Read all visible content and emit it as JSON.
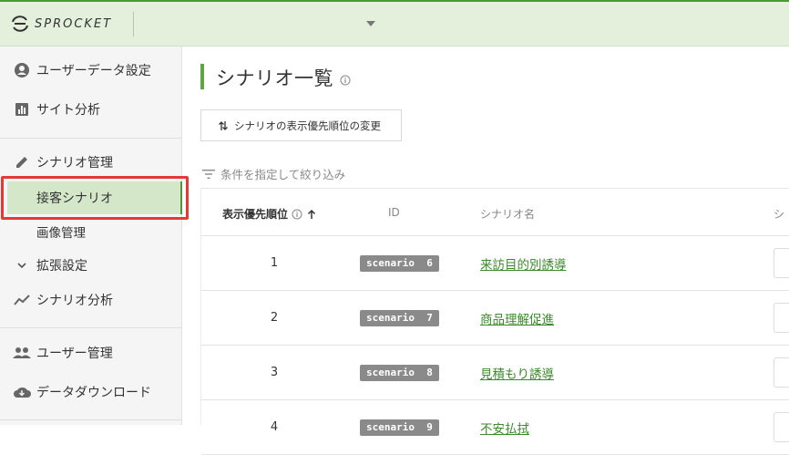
{
  "header": {
    "logo_text": "SPROCKET"
  },
  "sidebar": {
    "items": [
      {
        "label": "ユーザーデータ設定",
        "icon": "account-circle-icon"
      },
      {
        "label": "サイト分析",
        "icon": "bar-chart-icon"
      },
      {
        "label": "シナリオ管理",
        "icon": "pencil-icon"
      },
      {
        "label": "接客シナリオ",
        "active": true
      },
      {
        "label": "画像管理"
      },
      {
        "label": "拡張設定",
        "icon": "chevron-down-icon"
      },
      {
        "label": "シナリオ分析",
        "icon": "trending-up-icon"
      },
      {
        "label": "ユーザー管理",
        "icon": "people-icon"
      },
      {
        "label": "データダウンロード",
        "icon": "cloud-download-icon"
      }
    ]
  },
  "main": {
    "title": "シナリオ一覧",
    "sort_button_label": "シナリオの表示優先順位の変更",
    "filter_label": "条件を指定して絞り込み",
    "table": {
      "headers": {
        "priority": "表示優先順位",
        "id": "ID",
        "name": "シナリオ名",
        "more": "シ"
      },
      "rows": [
        {
          "priority": "1",
          "id": "scenario  6",
          "name": "来訪目的別誘導"
        },
        {
          "priority": "2",
          "id": "scenario  7",
          "name": "商品理解促進"
        },
        {
          "priority": "3",
          "id": "scenario  8",
          "name": "見積もり誘導"
        },
        {
          "priority": "4",
          "id": "scenario  9",
          "name": "不安払拭"
        }
      ]
    }
  },
  "colors": {
    "header_bg": "#e4f0dc",
    "accent": "#4c9a37",
    "link": "#3c8a2d",
    "highlight": "#e53935"
  }
}
